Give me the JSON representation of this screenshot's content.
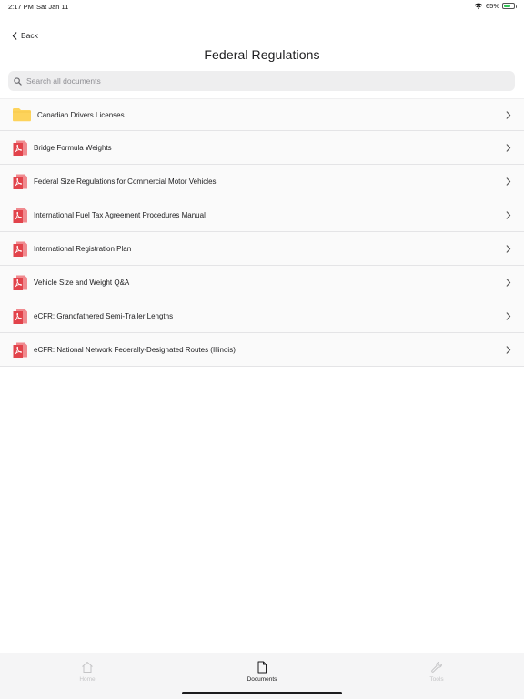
{
  "status_bar": {
    "time": "2:17 PM",
    "date": "Sat Jan 11",
    "battery_percent_label": "65%",
    "battery_level": 0.65,
    "wifi_icon": "wifi-icon",
    "battery_icon": "battery-icon",
    "battery_color": "#34c759"
  },
  "nav": {
    "back_label": "Back",
    "back_icon": "chevron-left-icon",
    "title": "Federal Regulations"
  },
  "search": {
    "placeholder": "Search all documents",
    "value": "",
    "icon": "search-icon"
  },
  "documents": [
    {
      "label": "Canadian Drivers Licenses",
      "type": "folder",
      "icon": "folder-icon"
    },
    {
      "label": "Bridge Formula Weights",
      "type": "pdf",
      "icon": "pdf-icon"
    },
    {
      "label": "Federal Size Regulations for Commercial Motor Vehicles",
      "type": "pdf",
      "icon": "pdf-icon"
    },
    {
      "label": "International Fuel Tax Agreement Procedures Manual",
      "type": "pdf",
      "icon": "pdf-icon"
    },
    {
      "label": "International Registration Plan",
      "type": "pdf",
      "icon": "pdf-icon"
    },
    {
      "label": "Vehicle Size and Weight Q&A",
      "type": "pdf",
      "icon": "pdf-icon"
    },
    {
      "label": "eCFR: Grandfathered Semi-Trailer Lengths",
      "type": "pdf",
      "icon": "pdf-icon"
    },
    {
      "label": "eCFR: National Network Federally-Designated Routes (Illinois)",
      "type": "pdf",
      "icon": "pdf-icon"
    }
  ],
  "tab_bar": {
    "home": {
      "label": "Home",
      "icon": "home-icon",
      "selected": false
    },
    "documents": {
      "label": "Documents",
      "icon": "document-icon",
      "selected": true
    },
    "tools": {
      "label": "Tools",
      "icon": "wrench-icon",
      "selected": false
    }
  },
  "colors": {
    "folder": "#fdd35b",
    "pdf": "#e2434b",
    "accent_text": "#1c1c1e",
    "inactive_tab": "#c4c4c6"
  }
}
